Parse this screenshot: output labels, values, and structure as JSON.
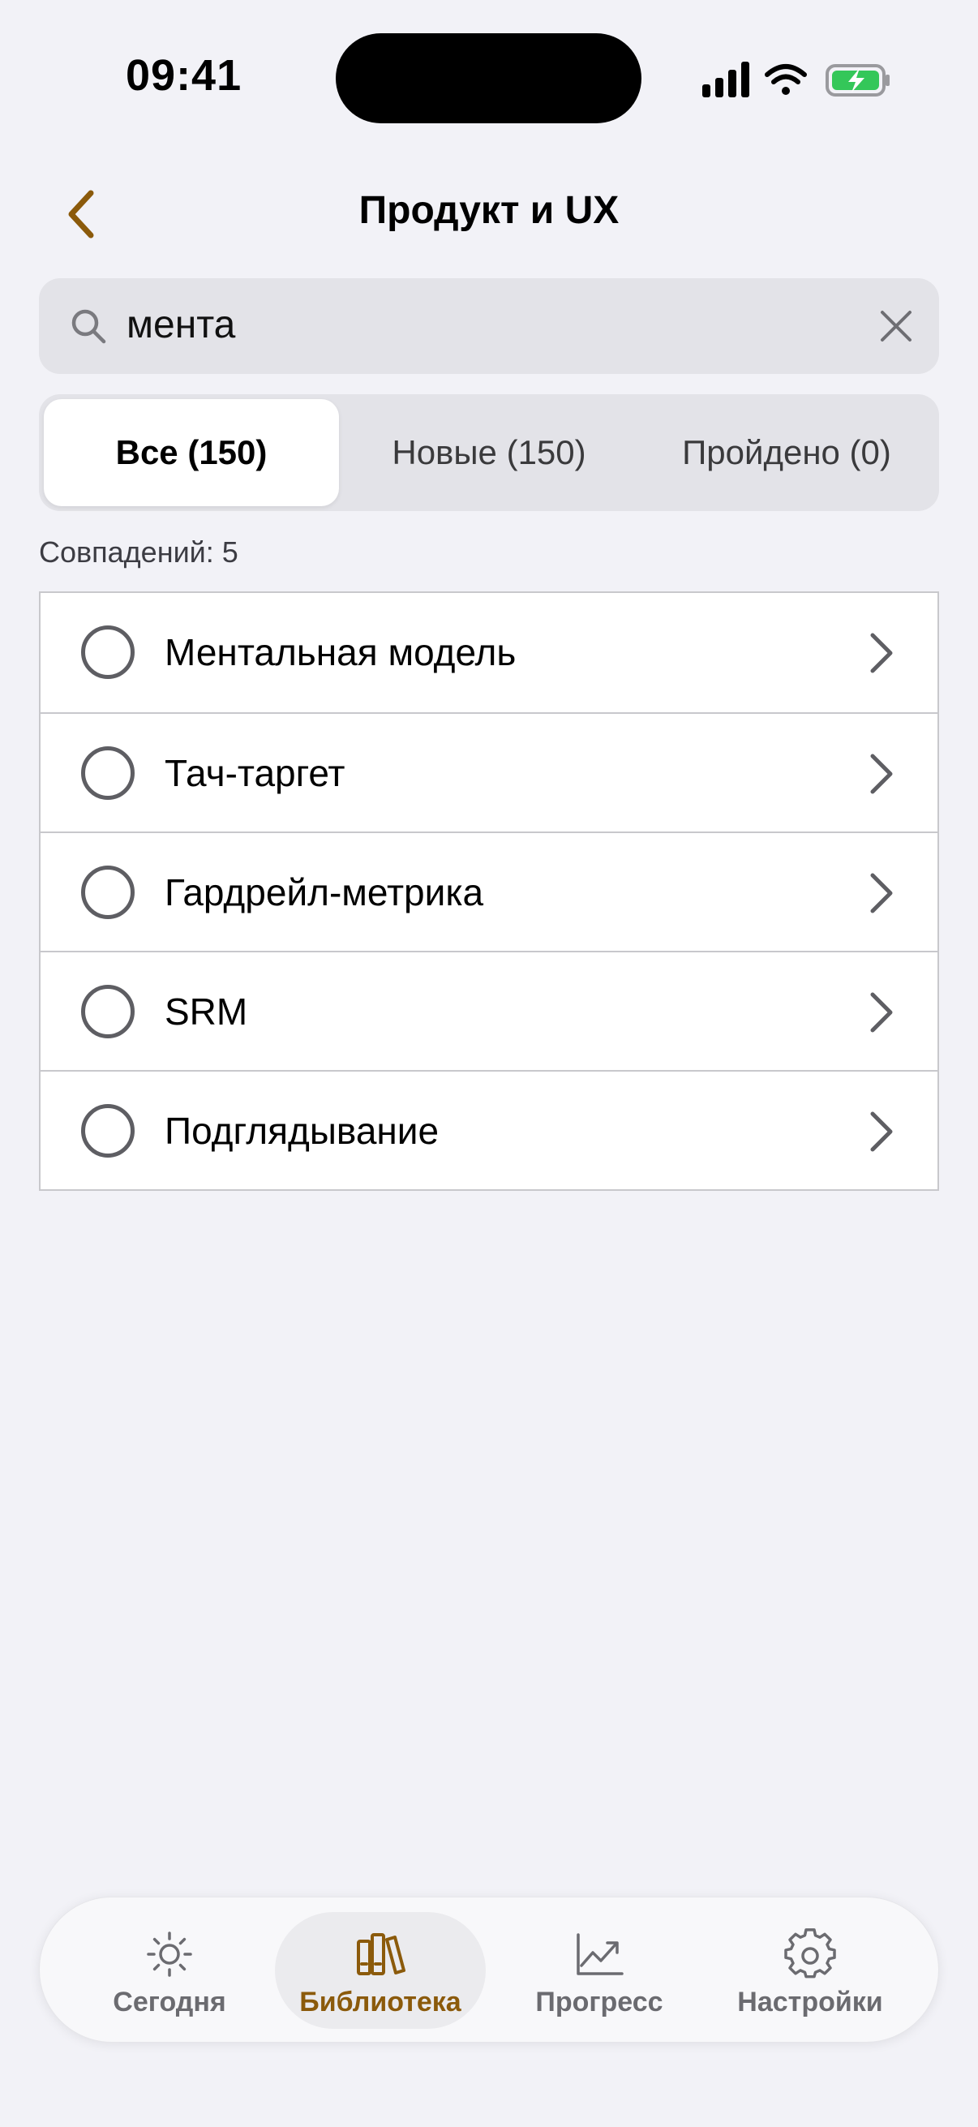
{
  "status": {
    "time": "09:41"
  },
  "nav": {
    "title": "Продукт и UX"
  },
  "search": {
    "value": "мента"
  },
  "segments": [
    {
      "label": "Все (150)",
      "active": true
    },
    {
      "label": "Новые (150)",
      "active": false
    },
    {
      "label": "Пройдено (0)",
      "active": false
    }
  ],
  "results": {
    "count_text": "Совпадений: 5"
  },
  "items": [
    {
      "label": "Ментальная модель"
    },
    {
      "label": "Тач-таргет"
    },
    {
      "label": "Гардрейл-метрика"
    },
    {
      "label": "SRM"
    },
    {
      "label": "Подглядывание"
    }
  ],
  "tabs": [
    {
      "label": "Сегодня",
      "icon": "sun-icon",
      "active": false
    },
    {
      "label": "Библиотека",
      "icon": "books-icon",
      "active": true
    },
    {
      "label": "Прогресс",
      "icon": "chart-icon",
      "active": false
    },
    {
      "label": "Настройки",
      "icon": "gear-icon",
      "active": false
    }
  ],
  "colors": {
    "accent": "#8b5a0b",
    "background": "#f2f2f7",
    "battery": "#34c759"
  }
}
